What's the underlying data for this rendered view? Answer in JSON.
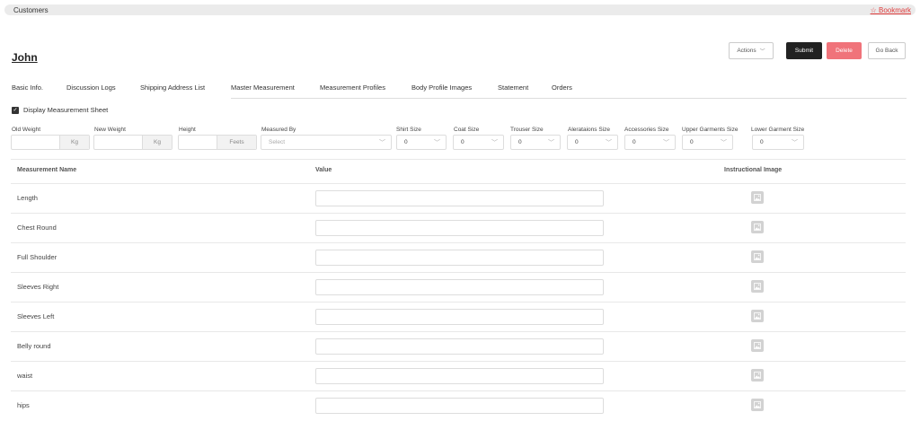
{
  "breadcrumb": {
    "current": "Customers"
  },
  "bookmark": {
    "label": "☆ Bookmark"
  },
  "customer": {
    "name": "John"
  },
  "actions": {
    "actions_label": "Actions",
    "submit_label": "Submit",
    "delete_label": "Delete",
    "goback_label": "Go Back"
  },
  "tabs": [
    {
      "label": "Basic Info."
    },
    {
      "label": "Discussion Logs"
    },
    {
      "label": "Shipping Address List"
    },
    {
      "label": "Master Measurement",
      "active": true
    },
    {
      "label": "Measurement Profiles"
    },
    {
      "label": "Body Profile Images"
    },
    {
      "label": "Statement"
    },
    {
      "label": "Orders"
    }
  ],
  "display_sheet": {
    "label": "Display Measurement Sheet",
    "checked": true
  },
  "fields": {
    "old_weight": {
      "label": "Old Weight",
      "value": "",
      "unit": "Kg"
    },
    "new_weight": {
      "label": "New Weight",
      "value": "",
      "unit": "Kg"
    },
    "height": {
      "label": "Height",
      "value": "",
      "unit": "Feets"
    },
    "measured_by": {
      "label": "Measured By",
      "placeholder": "Select"
    },
    "shirt_size": {
      "label": "Shirt Size",
      "value": "0"
    },
    "coat_size": {
      "label": "Coat Size",
      "value": "0"
    },
    "trouser_size": {
      "label": "Trouser Size",
      "value": "0"
    },
    "alterations_size": {
      "label": "Alerataions Size",
      "value": "0"
    },
    "accessories_size": {
      "label": "Accessories Size",
      "value": "0"
    },
    "upper_garments_size": {
      "label": "Upper Garments Size",
      "value": "0"
    },
    "lower_garment_size": {
      "label": "Lower Garment Size",
      "value": "0"
    }
  },
  "table": {
    "headers": {
      "name": "Measurement Name",
      "value": "Value",
      "image": "Instructional Image"
    },
    "rows": [
      {
        "name": "Length",
        "value": ""
      },
      {
        "name": "Chest Round",
        "value": ""
      },
      {
        "name": "Full Shoulder",
        "value": ""
      },
      {
        "name": "Sleeves Right",
        "value": ""
      },
      {
        "name": "Sleeves Left",
        "value": ""
      },
      {
        "name": "Belly round",
        "value": ""
      },
      {
        "name": "waist",
        "value": ""
      },
      {
        "name": "hips",
        "value": ""
      }
    ]
  },
  "icons": {
    "chevron": "chevron-down-icon",
    "image": "image-placeholder-icon",
    "check": "checkmark-icon",
    "star": "star-icon"
  },
  "colors": {
    "submit": "#222222",
    "delete": "#f0737a",
    "bookmark": "#e03b3b"
  }
}
